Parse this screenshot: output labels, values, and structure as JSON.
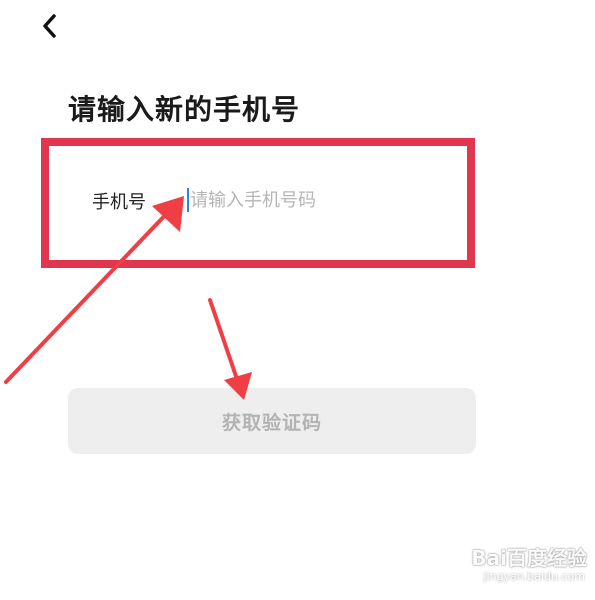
{
  "header": {
    "back_icon": "chevron-left-icon"
  },
  "page_title": "请输入新的手机号",
  "phone_field": {
    "label": "手机号",
    "value": "",
    "placeholder": "请输入手机号码"
  },
  "get_code_button": {
    "label": "获取验证码"
  },
  "annotation": {
    "highlight_color": "#e0374f",
    "arrow_color": "#f03e45"
  },
  "watermark": {
    "logo_text": "Bai百度经验",
    "url": "jingyan.baidu.com"
  },
  "colors": {
    "background": "#ffffff",
    "title": "#1a1a1a",
    "placeholder": "#b5b5b5",
    "caret": "#2f80ed",
    "disabled_button_bg": "#eeeeee",
    "disabled_button_text": "#b3b3b3"
  }
}
